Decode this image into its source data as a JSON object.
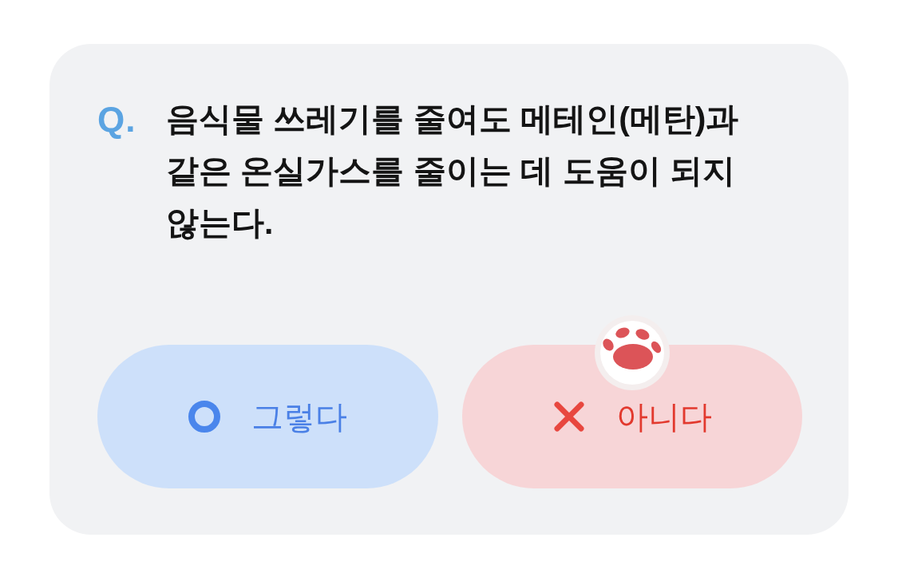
{
  "question": {
    "marker": "Q.",
    "text": "음식물 쓰레기를 줄여도 메테인(메탄)과 같은 온실가스를 줄이는 데 도움이 되지 않는다."
  },
  "options": [
    {
      "kind": "o",
      "label": "그렇다",
      "selected": false
    },
    {
      "kind": "x",
      "label": "아니다",
      "selected": true
    }
  ]
}
